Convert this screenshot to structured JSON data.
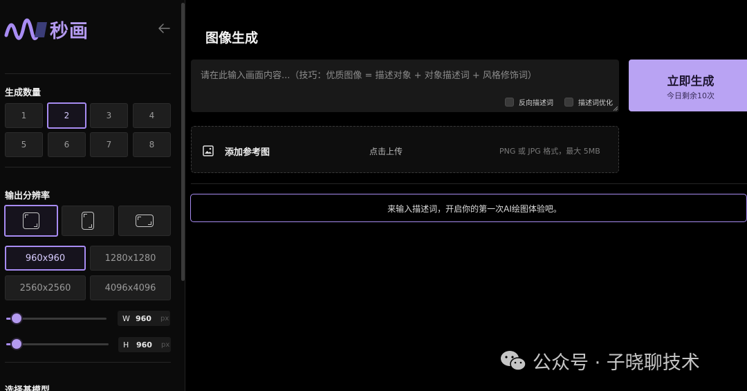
{
  "brand": {
    "name": "秒画"
  },
  "sidebar": {
    "count": {
      "title": "生成数量",
      "options": [
        "1",
        "2",
        "3",
        "4",
        "5",
        "6",
        "7",
        "8"
      ],
      "selected": "2"
    },
    "resolution": {
      "title": "输出分辨率",
      "aspect_icons": [
        "square-aspect-icon",
        "portrait-aspect-icon",
        "landscape-aspect-icon"
      ],
      "selected_aspect": "square",
      "sizes": [
        "960x960",
        "1280x1280",
        "2560x2560",
        "4096x4096"
      ],
      "selected_size": "960x960"
    },
    "width": {
      "label": "W",
      "value": "960",
      "unit": "px",
      "slider_fraction": 0.1
    },
    "height": {
      "label": "H",
      "value": "960",
      "unit": "px",
      "slider_fraction": 0.1
    },
    "next_section_title": "选择基模型"
  },
  "main": {
    "title": "图像生成",
    "prompt": {
      "value": "",
      "placeholder": "请在此输入画面内容...（技巧：优质图像 = 描述对象 + 对象描述词 + 风格修饰词）",
      "negative_label": "反向描述词",
      "optimize_label": "描述词优化"
    },
    "generate": {
      "label": "立即生成",
      "remaining": "今日剩余10次"
    },
    "upload": {
      "label": "添加参考图",
      "click": "点击上传",
      "hint": "PNG 或 JPG 格式，最大 5MB"
    },
    "empty_message": "来输入描述词，开启你的第一次AI绘图体验吧。"
  },
  "watermark": {
    "text": "公众号 · 子晓聊技术"
  },
  "colors": {
    "accent": "#a88cf3",
    "button": "#b9a3f3",
    "background": "#000000"
  }
}
